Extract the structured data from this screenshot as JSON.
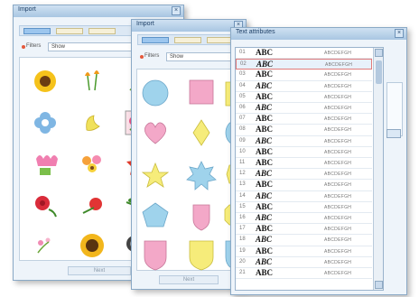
{
  "colors": {
    "title_bar": "#b7d1ea",
    "panel": "#eef4fa",
    "selection": "#e07a7a"
  },
  "window1": {
    "title": "Import",
    "filter_label": "Filters",
    "filter_value": "Show",
    "footer_button": "Next",
    "items": [
      {
        "icon": "sunflower-icon"
      },
      {
        "icon": "tulip-pair-icon"
      },
      {
        "icon": "flower-sprig-icon"
      },
      {
        "icon": "blue-flower-icon"
      },
      {
        "icon": "yellow-lily-icon"
      },
      {
        "icon": "rose-bouquet-icon"
      },
      {
        "icon": "pink-tulip-icon"
      },
      {
        "icon": "daisy-cluster-icon"
      },
      {
        "icon": "red-star-flower-icon"
      },
      {
        "icon": "red-rose-icon"
      },
      {
        "icon": "red-poppy-icon"
      },
      {
        "icon": "berry-branch-icon"
      },
      {
        "icon": "pink-spray-icon"
      },
      {
        "icon": "sunflower-large-icon"
      },
      {
        "icon": "dark-bouquet-icon"
      }
    ]
  },
  "window2": {
    "title": "Import",
    "filter_label": "Filters",
    "filter_value": "Show",
    "footer_button": "Next",
    "shapes": [
      {
        "icon": "circle-shape-icon",
        "color": "#9fd3ec"
      },
      {
        "icon": "square-shape-icon",
        "color": "#f3a8c8"
      },
      {
        "icon": "badge-shape-icon",
        "color": "#f6ec7a"
      },
      {
        "icon": "heart-shape-icon",
        "color": "#f3a8c8"
      },
      {
        "icon": "diamond-shape-icon",
        "color": "#f6ec7a"
      },
      {
        "icon": "oval-shape-icon",
        "color": "#9fd3ec"
      },
      {
        "icon": "star-shape-icon",
        "color": "#f6ec7a"
      },
      {
        "icon": "burst-shape-icon",
        "color": "#9fd3ec"
      },
      {
        "icon": "hexagon-shape-icon",
        "color": "#f6ec7a"
      },
      {
        "icon": "pentagon-shape-icon",
        "color": "#9fd3ec"
      },
      {
        "icon": "shield-shape-icon",
        "color": "#f3a8c8"
      },
      {
        "icon": "octagon-shape-icon",
        "color": "#f6ec7a"
      },
      {
        "icon": "shield-shape-icon",
        "color": "#f3a8c8"
      },
      {
        "icon": "shield-shape-icon",
        "color": "#f6ec7a"
      },
      {
        "icon": "shield-shape-icon",
        "color": "#9fd3ec"
      }
    ]
  },
  "window3": {
    "title": "Text attributes",
    "fonts": [
      {
        "num": "01",
        "sample": "ABC",
        "preview": "ABCDEFGH"
      },
      {
        "num": "02",
        "sample": "ABC",
        "preview": "ABCDEFGH"
      },
      {
        "num": "03",
        "sample": "ABC",
        "preview": "ABCDEFGH"
      },
      {
        "num": "04",
        "sample": "ABC",
        "preview": "ABCDEFGH"
      },
      {
        "num": "05",
        "sample": "ABC",
        "preview": "ABCDEFGH"
      },
      {
        "num": "06",
        "sample": "ABC",
        "preview": "ABCDEFGH"
      },
      {
        "num": "07",
        "sample": "ABC",
        "preview": "ABCDEFGH"
      },
      {
        "num": "08",
        "sample": "ABC",
        "preview": "ABCDEFGH"
      },
      {
        "num": "09",
        "sample": "ABC",
        "preview": "ABCDEFGH"
      },
      {
        "num": "10",
        "sample": "ABC",
        "preview": "ABCDEFGH"
      },
      {
        "num": "11",
        "sample": "ABC",
        "preview": "ABCDEFGH"
      },
      {
        "num": "12",
        "sample": "ABC",
        "preview": "ABCDEFGH"
      },
      {
        "num": "13",
        "sample": "ABC",
        "preview": "ABCDEFGH"
      },
      {
        "num": "14",
        "sample": "ABC",
        "preview": "ABCDEFGH"
      },
      {
        "num": "15",
        "sample": "ABC",
        "preview": "ABCDEFGH"
      },
      {
        "num": "16",
        "sample": "ABC",
        "preview": "ABCDEFGH"
      },
      {
        "num": "17",
        "sample": "ABC",
        "preview": "ABCDEFGH"
      },
      {
        "num": "18",
        "sample": "ABC",
        "preview": "ABCDEFGH"
      },
      {
        "num": "19",
        "sample": "ABC",
        "preview": "ABCDEFGH"
      },
      {
        "num": "20",
        "sample": "ABC",
        "preview": "ABCDEFGH"
      },
      {
        "num": "21",
        "sample": "ABC",
        "preview": "ABCDEFGH"
      }
    ],
    "selected_index": 1
  }
}
